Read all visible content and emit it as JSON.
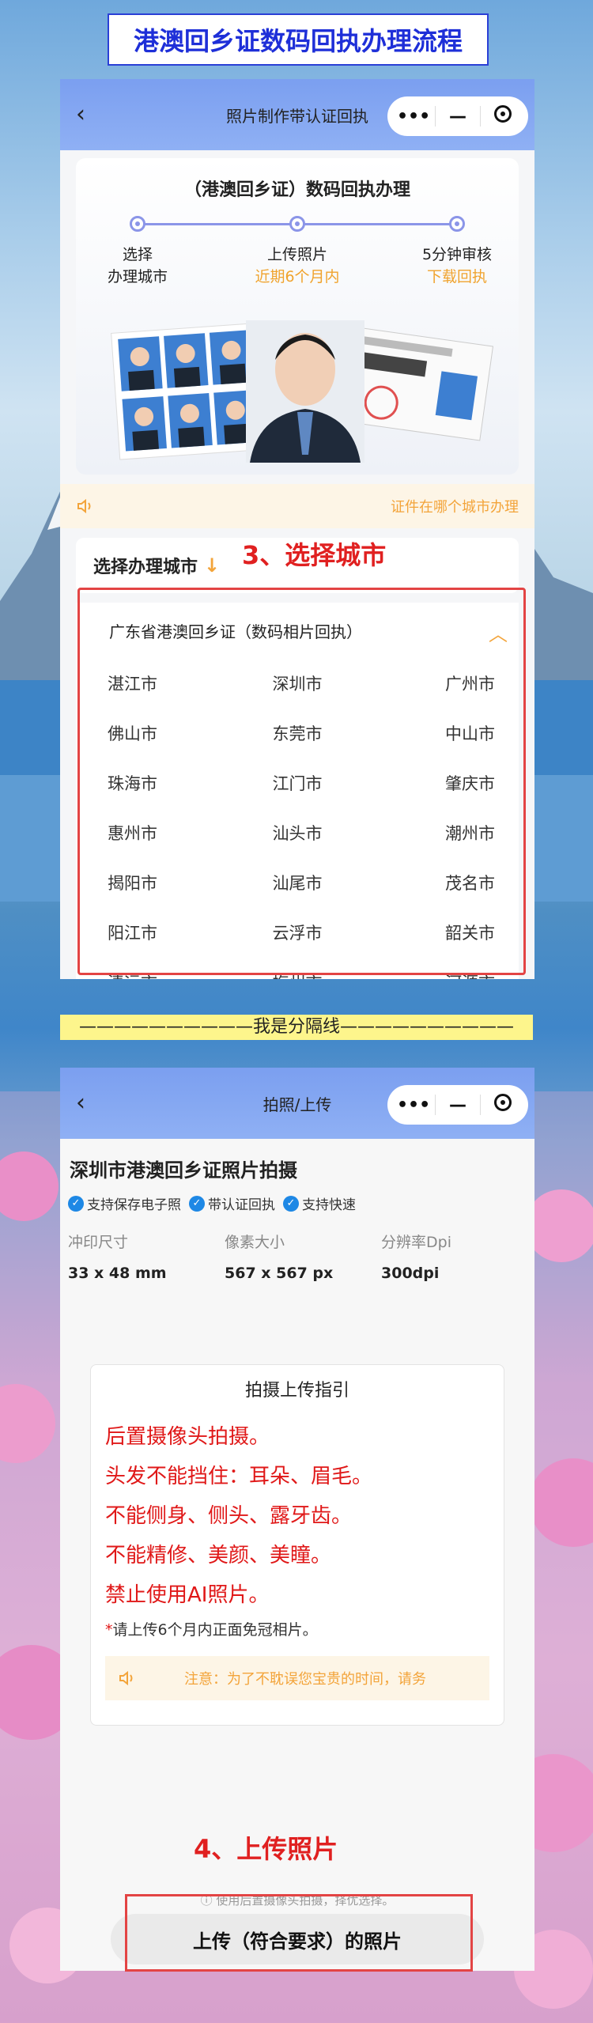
{
  "page_title": "港澳回乡证数码回执办理流程",
  "panel1": {
    "nav_title": "照片制作带认证回执",
    "hero_title": "（港澳回乡证）数码回执办理",
    "steps": [
      {
        "line1": "选择",
        "line2": "办理城市"
      },
      {
        "line1": "上传照片",
        "line2": "近期6个月内"
      },
      {
        "line1": "5分钟审核",
        "line2": "下载回执"
      }
    ],
    "notice": "证件在哪个城市办理",
    "select_label": "选择办理城市",
    "annotation": "3、选择城市",
    "province": "广东省港澳回乡证（数码相片回执）",
    "cities": [
      "湛江市",
      "深圳市",
      "广州市",
      "佛山市",
      "东莞市",
      "中山市",
      "珠海市",
      "江门市",
      "肇庆市",
      "惠州市",
      "汕头市",
      "潮州市",
      "揭阳市",
      "汕尾市",
      "茂名市",
      "阳江市",
      "云浮市",
      "韶关市",
      "清远市",
      "梅州市",
      "河源市"
    ]
  },
  "divider": "——————————我是分隔线——————————",
  "panel2": {
    "nav_title": "拍照/上传",
    "title": "深圳市港澳回乡证照片拍摄",
    "tags": [
      "支持保存电子照",
      "带认证回执",
      "支持快速"
    ],
    "specs": [
      {
        "label": "冲印尺寸",
        "value": "33 x 48 mm"
      },
      {
        "label": "像素大小",
        "value": "567 x 567 px"
      },
      {
        "label": "分辨率Dpi",
        "value": "300dpi"
      }
    ],
    "guide_title": "拍摄上传指引",
    "guide_items": [
      "后置摄像头拍摄。",
      "头发不能挡住：耳朵、眉毛。",
      "不能侧身、侧头、露牙齿。",
      "不能精修、美颜、美瞳。",
      "禁止使用AI照片。"
    ],
    "guide_note_star": "*",
    "guide_note": "请上传6个月内正面免冠相片。",
    "guide_tip": "注意：为了不耽误您宝贵的时间，请务",
    "annotation": "4、上传照片",
    "hint": "使用后置摄像头拍摄，择优选择。",
    "upload_label": "上传（符合要求）的照片"
  },
  "icons": {
    "back": "chevron-left-icon",
    "more": "more-dots-icon",
    "minimize": "minus-icon",
    "close": "target-ring-icon",
    "speaker": "speaker-icon",
    "check": "check-circle-icon"
  },
  "colors": {
    "title_blue": "#1e2fd8",
    "nav_blue": "#7b9ff0",
    "orange": "#f3a43a",
    "red": "#e01818",
    "divider_yellow": "#fdf58c"
  }
}
